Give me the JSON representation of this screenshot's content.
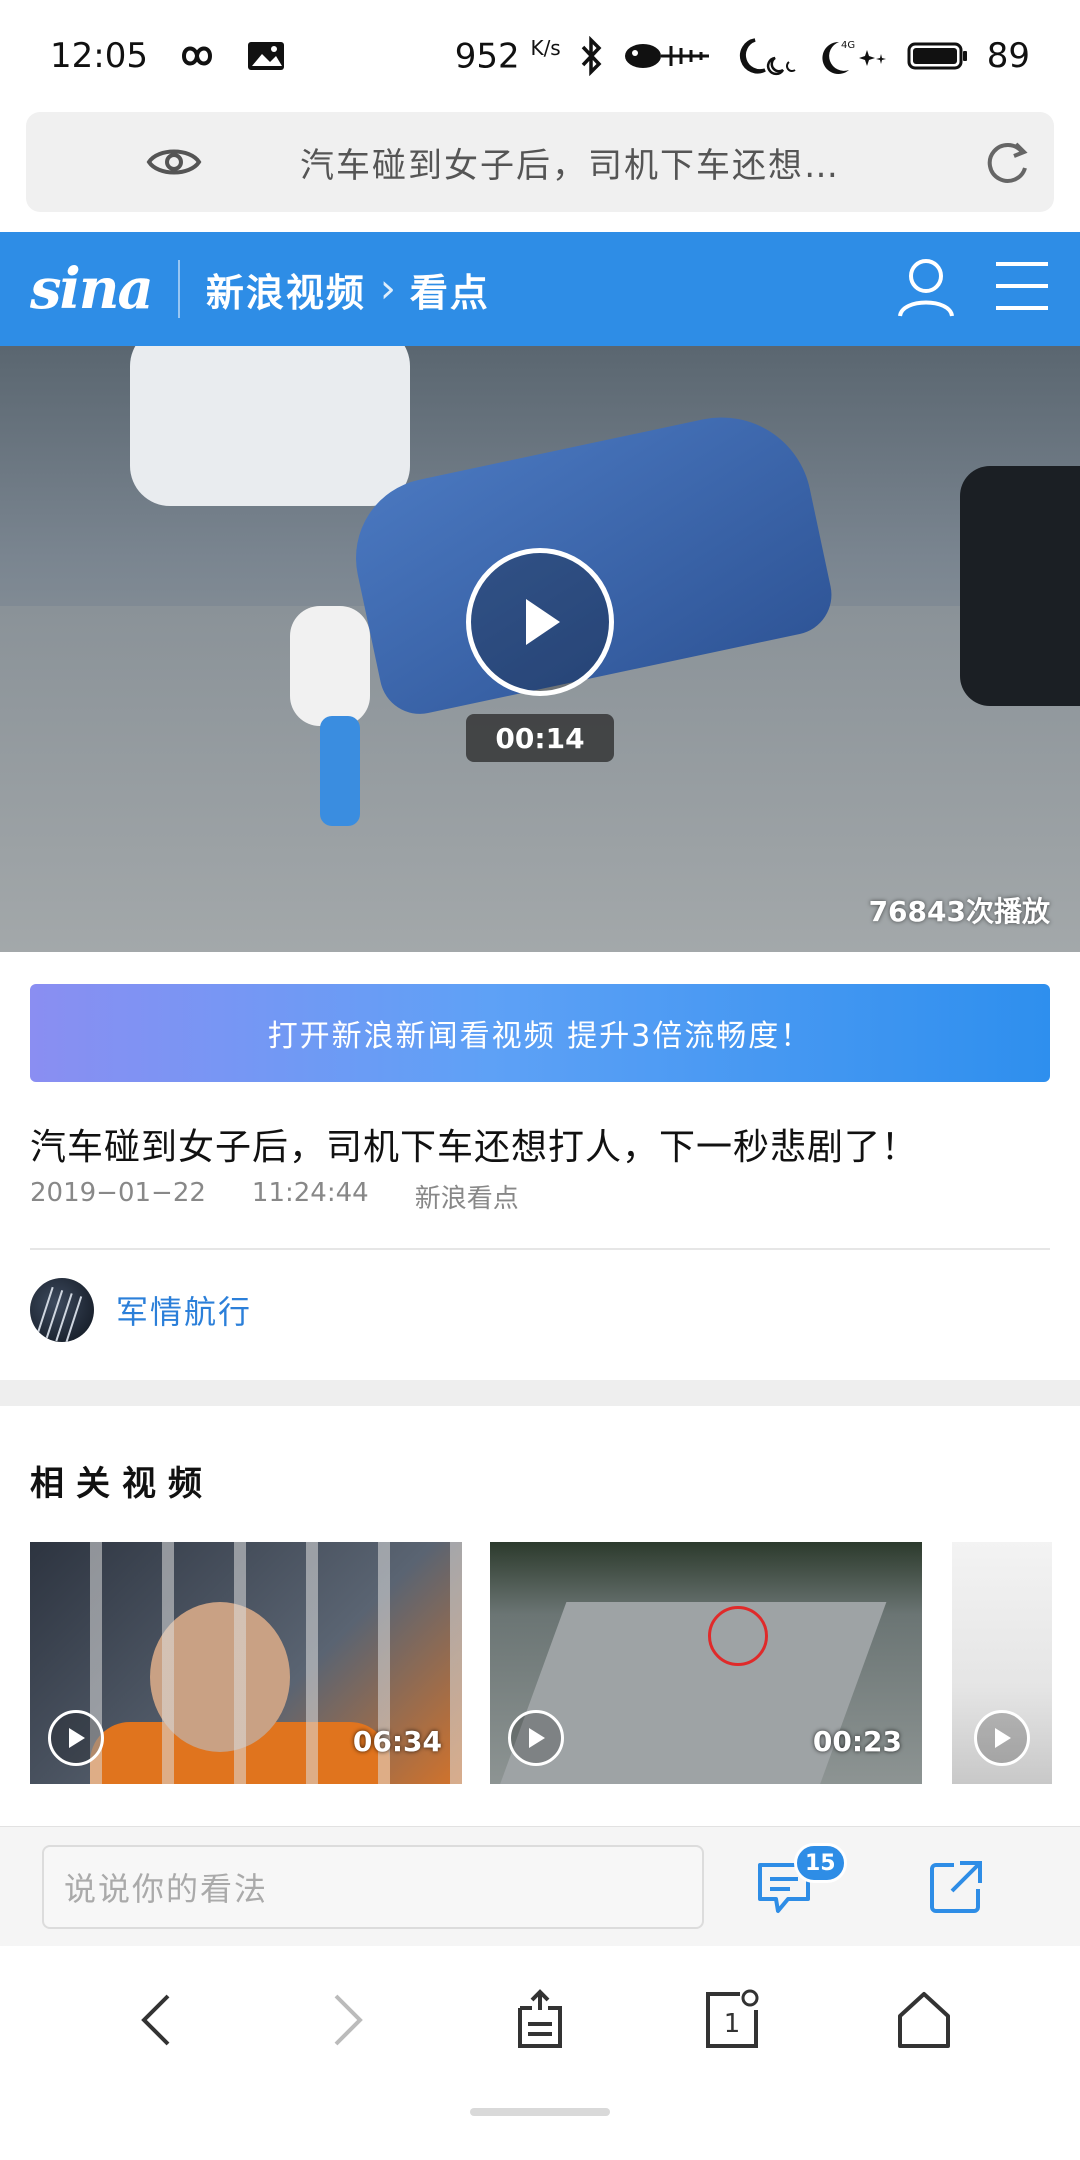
{
  "status_bar": {
    "time": "12:05",
    "net_speed": "952",
    "net_speed_unit": "K/s",
    "battery": "89",
    "icons": [
      "infinity-icon",
      "gallery-icon",
      "bluetooth-icon",
      "fish-icon",
      "moon-icon",
      "signal-4g-icon",
      "battery-icon"
    ]
  },
  "url_bar": {
    "text": "汽车碰到女子后，司机下车还想…",
    "icons": [
      "eye-icon",
      "reload-icon"
    ]
  },
  "site_header": {
    "logo": "sina",
    "section": "新浪视频",
    "subsection": "看点",
    "accent_color": "#2e8de6",
    "icons": [
      "user-icon",
      "menu-icon"
    ]
  },
  "video": {
    "duration": "00:14",
    "plays": "76843次播放"
  },
  "banner": {
    "text": "打开新浪新闻看视频 提升3倍流畅度！"
  },
  "article": {
    "title": "汽车碰到女子后，司机下车还想打人，下一秒悲剧了！",
    "date": "2019−01−22",
    "time": "11:24:44",
    "source": "新浪看点"
  },
  "author": {
    "name": "军情航行"
  },
  "related": {
    "heading": "相关视频",
    "items": [
      {
        "duration": "06:34"
      },
      {
        "duration": "00:23"
      },
      {
        "duration": ""
      }
    ]
  },
  "comment_bar": {
    "placeholder": "说说你的看法",
    "comment_count": "15"
  },
  "nav": {
    "tab_count": "1",
    "icons": [
      "back-icon",
      "forward-icon",
      "share-tray-icon",
      "tabs-icon",
      "home-icon"
    ]
  }
}
